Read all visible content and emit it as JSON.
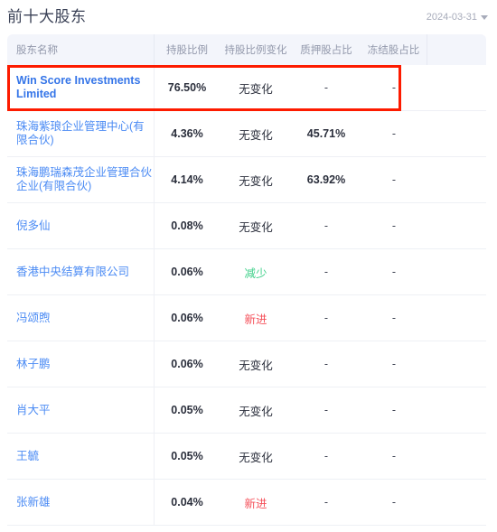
{
  "header": {
    "title": "前十大股东",
    "date_value": "2024-03-31",
    "caret_icon": "chevron-down-icon"
  },
  "table": {
    "columns": [
      {
        "key": "name",
        "label": "股东名称"
      },
      {
        "key": "ratio",
        "label": "持股比例"
      },
      {
        "key": "change",
        "label": "持股比例变化"
      },
      {
        "key": "pledge",
        "label": "质押股占比"
      },
      {
        "key": "frozen",
        "label": "冻结股占比"
      },
      {
        "key": "tail",
        "label": ""
      }
    ],
    "rows": [
      {
        "name": "Win Score Investments Limited",
        "ratio": "76.50%",
        "change": "无变化",
        "change_kind": "none",
        "pledge": "-",
        "frozen": "-",
        "highlighted": true
      },
      {
        "name": "珠海紫琅企业管理中心(有限合伙)",
        "ratio": "4.36%",
        "change": "无变化",
        "change_kind": "none",
        "pledge": "45.71%",
        "frozen": "-",
        "highlighted": false
      },
      {
        "name": "珠海鹏瑞森茂企业管理合伙企业(有限合伙)",
        "ratio": "4.14%",
        "change": "无变化",
        "change_kind": "none",
        "pledge": "63.92%",
        "frozen": "-",
        "highlighted": false
      },
      {
        "name": "倪多仙",
        "ratio": "0.08%",
        "change": "无变化",
        "change_kind": "none",
        "pledge": "-",
        "frozen": "-",
        "highlighted": false
      },
      {
        "name": "香港中央结算有限公司",
        "ratio": "0.06%",
        "change": "减少",
        "change_kind": "down",
        "pledge": "-",
        "frozen": "-",
        "highlighted": false
      },
      {
        "name": "冯颂煦",
        "ratio": "0.06%",
        "change": "新进",
        "change_kind": "up",
        "pledge": "-",
        "frozen": "-",
        "highlighted": false
      },
      {
        "name": "林子鹏",
        "ratio": "0.06%",
        "change": "无变化",
        "change_kind": "none",
        "pledge": "-",
        "frozen": "-",
        "highlighted": false
      },
      {
        "name": "肖大平",
        "ratio": "0.05%",
        "change": "无变化",
        "change_kind": "none",
        "pledge": "-",
        "frozen": "-",
        "highlighted": false
      },
      {
        "name": "王毓",
        "ratio": "0.05%",
        "change": "无变化",
        "change_kind": "none",
        "pledge": "-",
        "frozen": "-",
        "highlighted": false
      },
      {
        "name": "张新雄",
        "ratio": "0.04%",
        "change": "新进",
        "change_kind": "up",
        "pledge": "-",
        "frozen": "-",
        "highlighted": false
      }
    ]
  },
  "colors": {
    "link_blue": "#4b8bf4",
    "link_blue_strong": "#3575e8",
    "up_red": "#f5505a",
    "down_green": "#3fd08a",
    "highlight_red": "#fd1b00",
    "header_bg": "#f3f5fb",
    "title": "#3b4257",
    "muted": "#9298ab"
  }
}
